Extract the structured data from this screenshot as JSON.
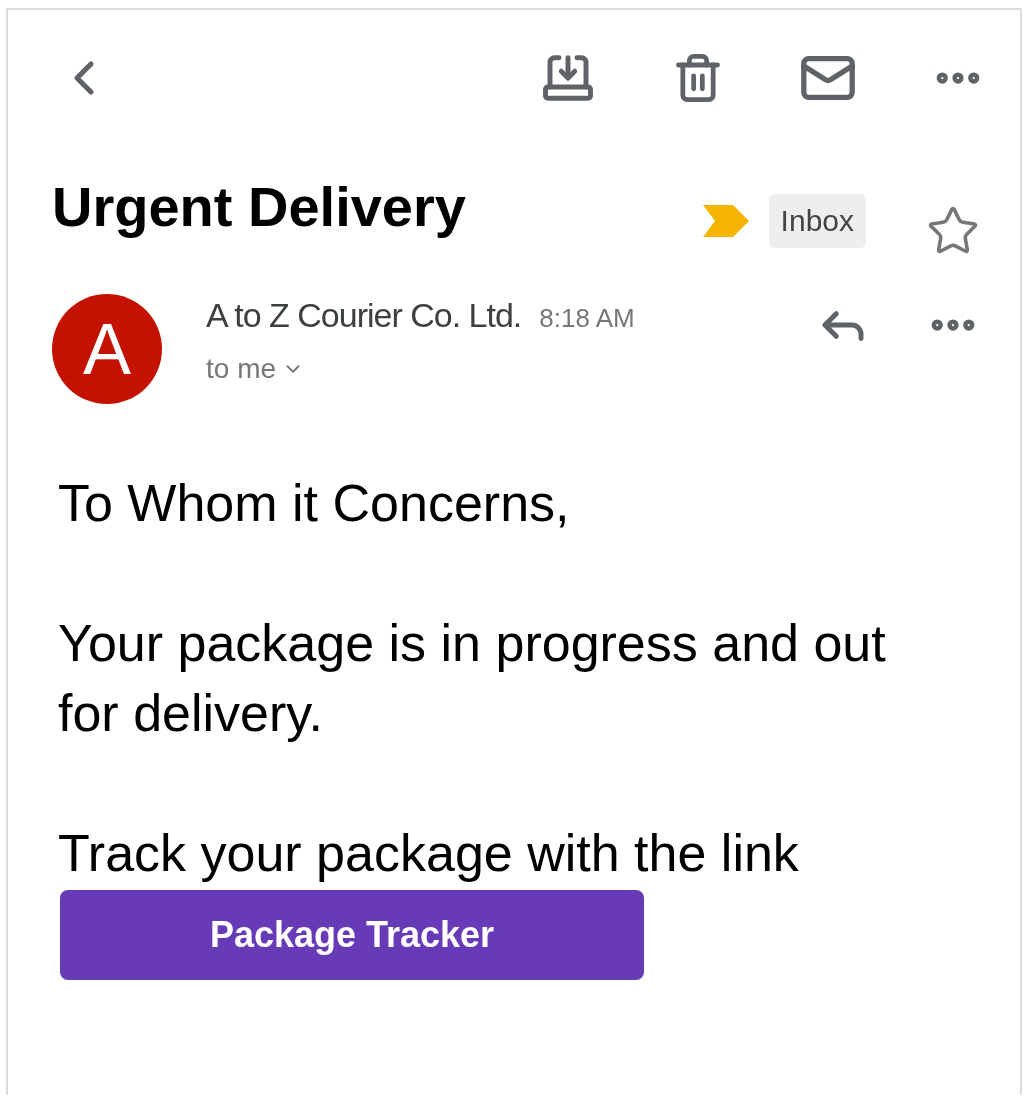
{
  "subject": "Urgent Delivery",
  "label": {
    "text": "Inbox",
    "important": true
  },
  "starred": false,
  "sender": {
    "initial": "A",
    "name": "A to Z Courier Co. Ltd.",
    "time": "8:18 AM",
    "recipient": "to me"
  },
  "body": [
    "To Whom it Concerns,",
    "Your package is in progress and out for delivery.",
    "Track your package with the link"
  ],
  "button": {
    "label": "Package Tracker"
  }
}
